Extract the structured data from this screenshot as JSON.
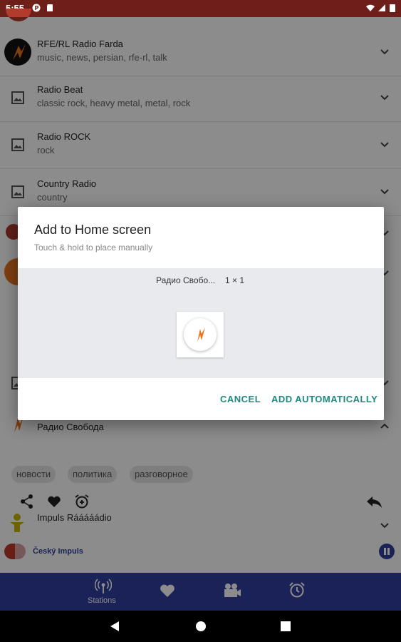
{
  "status_bar": {
    "time": "5:55"
  },
  "stations": [
    {
      "name": "RFE/RL Radio Farda",
      "tags": "music, news, persian, rfe-rl, talk",
      "icon": "radio-farda-logo"
    },
    {
      "name": "Radio Beat",
      "tags": "classic rock, heavy metal, metal, rock",
      "icon": "image-placeholder-icon"
    },
    {
      "name": "Radio ROCK",
      "tags": "rock",
      "icon": "image-placeholder-icon"
    },
    {
      "name": "Country Radio",
      "tags": "country",
      "icon": "image-placeholder-icon"
    }
  ],
  "expanded_station": {
    "name": "Радио Свобода",
    "chips": [
      "новости",
      "политика",
      "разговорное"
    ]
  },
  "next_station": {
    "name": "Impuls Rááááádio"
  },
  "mini_player": {
    "station": "Český Impuls"
  },
  "bottom_nav": {
    "stations_label": "Stations"
  },
  "dialog": {
    "title": "Add to Home screen",
    "subtitle": "Touch & hold to place manually",
    "widget_name": "Радио Свобо...",
    "widget_size": "1 × 1",
    "cancel": "CANCEL",
    "add": "ADD AUTOMATICALLY"
  },
  "colors": {
    "accent": "#1d8a80",
    "nav_bar": "#303f9f",
    "status_bar": "#6e1f1a",
    "logo_orange": "#e8741e"
  }
}
